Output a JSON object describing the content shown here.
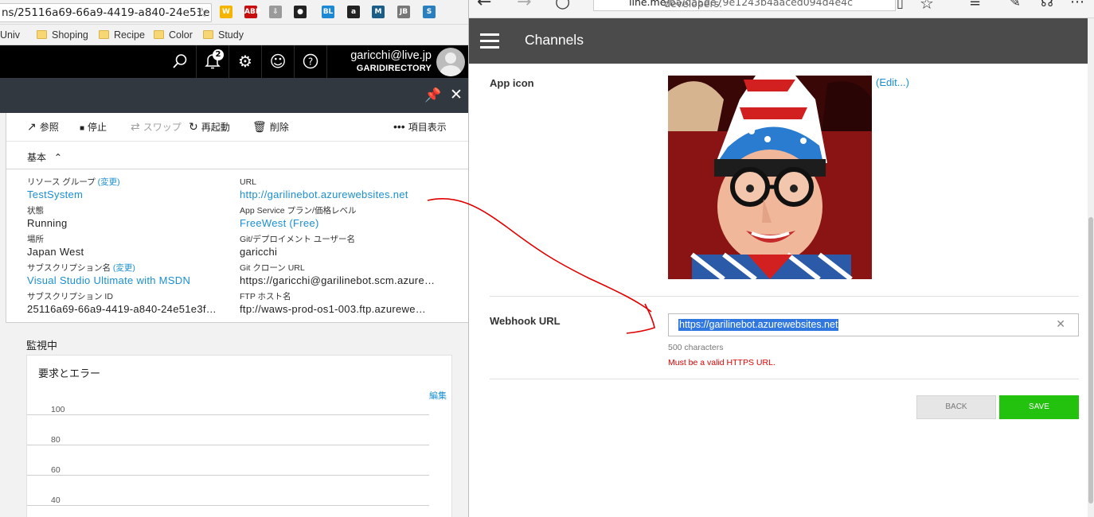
{
  "left_browser": {
    "url": "ns/25116a69-66a9-4419-a840-24e51e",
    "bookmarks": [
      "Univ",
      "Shoping",
      "Recipe",
      "Color",
      "Study"
    ],
    "extensions": [
      {
        "name": "w-icon",
        "label": "W",
        "color": "#f5b400"
      },
      {
        "name": "adblock-icon",
        "label": "ABP",
        "color": "#c70d0d"
      },
      {
        "name": "download-icon",
        "label": "⇩",
        "color": "#9a9a9a"
      },
      {
        "name": "bulb-icon",
        "label": "●",
        "color": "#222222"
      },
      {
        "name": "bl-icon",
        "label": "BL",
        "color": "#1d88d4"
      },
      {
        "name": "amazon-icon",
        "label": "a",
        "color": "#222222"
      },
      {
        "name": "m-icon",
        "label": "M",
        "color": "#1a5e88"
      },
      {
        "name": "jb-icon",
        "label": "JB",
        "color": "#777777"
      },
      {
        "name": "s-icon",
        "label": "S",
        "color": "#2a7fc1"
      }
    ]
  },
  "azure": {
    "notification_count": "2",
    "user_email": "garicchi@live.jp",
    "user_directory": "GARIDIRECTORY",
    "commands": {
      "browse": "参照",
      "stop": "停止",
      "swap": "スワップ",
      "restart": "再起動",
      "delete": "削除",
      "columns": "項目表示"
    },
    "section_title": "基本",
    "change_label": "(変更)",
    "props_left": [
      {
        "label": "リソース グループ",
        "value": "TestSystem"
      },
      {
        "label": "状態",
        "value": "Running"
      },
      {
        "label": "場所",
        "value": "Japan West"
      },
      {
        "label": "サブスクリプション名",
        "value": "Visual Studio Ultimate with MSDN"
      },
      {
        "label": "サブスクリプション ID",
        "value": "25116a69-66a9-4419-a840-24e51e3f…"
      }
    ],
    "props_right": [
      {
        "label": "URL",
        "value": "http://garilinebot.azurewebsites.net"
      },
      {
        "label": "App Service プラン/価格レベル",
        "value": "FreeWest (Free)"
      },
      {
        "label": "Git/デプロイメント ユーザー名",
        "value": "garicchi"
      },
      {
        "label": "Git クローン URL",
        "value": "https://garicchi@garilinebot.scm.azure…"
      },
      {
        "label": "FTP ホスト名",
        "value": "ftp://waws-prod-os1-003.ftp.azurewe…"
      }
    ],
    "monitor_title": "監視中",
    "chart_title": "要求とエラー",
    "chart_edit": "編集",
    "chart_ticks": [
      "100",
      "80",
      "60",
      "40"
    ]
  },
  "right_browser": {
    "url_prefix": "developers.",
    "url_host": "line.me",
    "url_path": "/ba/da5de79e1243b4aaced094d4e4c"
  },
  "line": {
    "header_title": "Channels",
    "app_icon_label": "App icon",
    "edit_link": "(Edit...)",
    "webhook_label": "Webhook URL",
    "webhook_value": "https://garilinebot.azurewebsites.net",
    "char_limit": "500 characters",
    "error_message": "Must be a valid HTTPS URL.",
    "back_label": "BACK",
    "save_label": "SAVE"
  },
  "colors": {
    "azure_link": "#1a8fd1",
    "line_header": "#4b4b4b",
    "save_green": "#22c20e",
    "error_red": "#e00000",
    "annotation_red": "#e00000"
  }
}
